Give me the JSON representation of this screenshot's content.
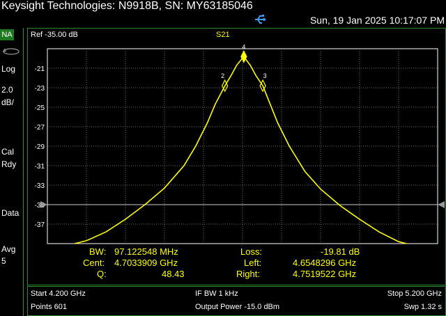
{
  "header": {
    "title": "Keysight Technologies: N9918B, SN: MY63185046",
    "datetime": "Sun, 19 Jan 2025 10:17:07 PM"
  },
  "left_panel": {
    "mode": "NA",
    "log_label": "Log",
    "scale_value": "2.0",
    "scale_unit": "dB/",
    "cal_label": "Cal",
    "rdy_label": "Rdy",
    "data_label": "Data",
    "avg_label": "Avg",
    "avg_value": "5"
  },
  "plot": {
    "ref_label": "Ref -35.00 dB",
    "trace_name": "S21",
    "trace_color": "#ffff00",
    "ref_line_color": "#cccccc"
  },
  "markers": {
    "labels": [
      "2",
      "3",
      "4"
    ]
  },
  "marker_table": {
    "bw_label": "BW:",
    "bw_value": "97.122548 MHz",
    "cent_label": "Cent:",
    "cent_value": "4.7033909 GHz",
    "q_label": "Q:",
    "q_value": "48.43",
    "loss_label": "Loss:",
    "loss_value": "-19.81 dB",
    "left_label": "Left:",
    "left_value": "4.6548296 GHz",
    "right_label": "Right:",
    "right_value": "4.7519522 GHz"
  },
  "footer": {
    "start": "Start 4.200 GHz",
    "points": "Points 601",
    "ifbw": "IF BW 1 kHz",
    "output_power": "Output Power -15.0 dBm",
    "stop": "Stop 5.200 GHz",
    "sweep": "Swp 1.32 s"
  },
  "chart_data": {
    "type": "line",
    "title": "S21",
    "xlabel": "",
    "ylabel": "",
    "xlim": [
      4.2,
      5.2
    ],
    "ylim": [
      -39,
      -19
    ],
    "y_ticks": [
      "-21",
      "-23",
      "-25",
      "-27",
      "-29",
      "-31",
      "-33",
      "-35",
      "-37"
    ],
    "reference_level": -35.0,
    "series": [
      {
        "name": "S21",
        "x": [
          4.27,
          4.3,
          4.35,
          4.4,
          4.45,
          4.5,
          4.55,
          4.58,
          4.61,
          4.63,
          4.655,
          4.67,
          4.685,
          4.703,
          4.72,
          4.735,
          4.752,
          4.77,
          4.79,
          4.82,
          4.86,
          4.9,
          4.95,
          5.0,
          5.05,
          5.1,
          5.12
        ],
        "y": [
          -39.0,
          -38.7,
          -37.8,
          -36.5,
          -35.0,
          -33.3,
          -31.0,
          -29.0,
          -26.6,
          -24.7,
          -22.8,
          -21.8,
          -20.7,
          -19.81,
          -20.7,
          -21.8,
          -22.8,
          -24.6,
          -26.6,
          -29.0,
          -31.6,
          -33.4,
          -35.1,
          -36.5,
          -37.8,
          -38.8,
          -39.0
        ]
      }
    ],
    "markers": [
      {
        "label": "2",
        "x": 4.6548,
        "y": -22.8
      },
      {
        "label": "3",
        "x": 4.752,
        "y": -22.8
      },
      {
        "label": "4",
        "x": 4.7034,
        "y": -19.81
      }
    ]
  }
}
